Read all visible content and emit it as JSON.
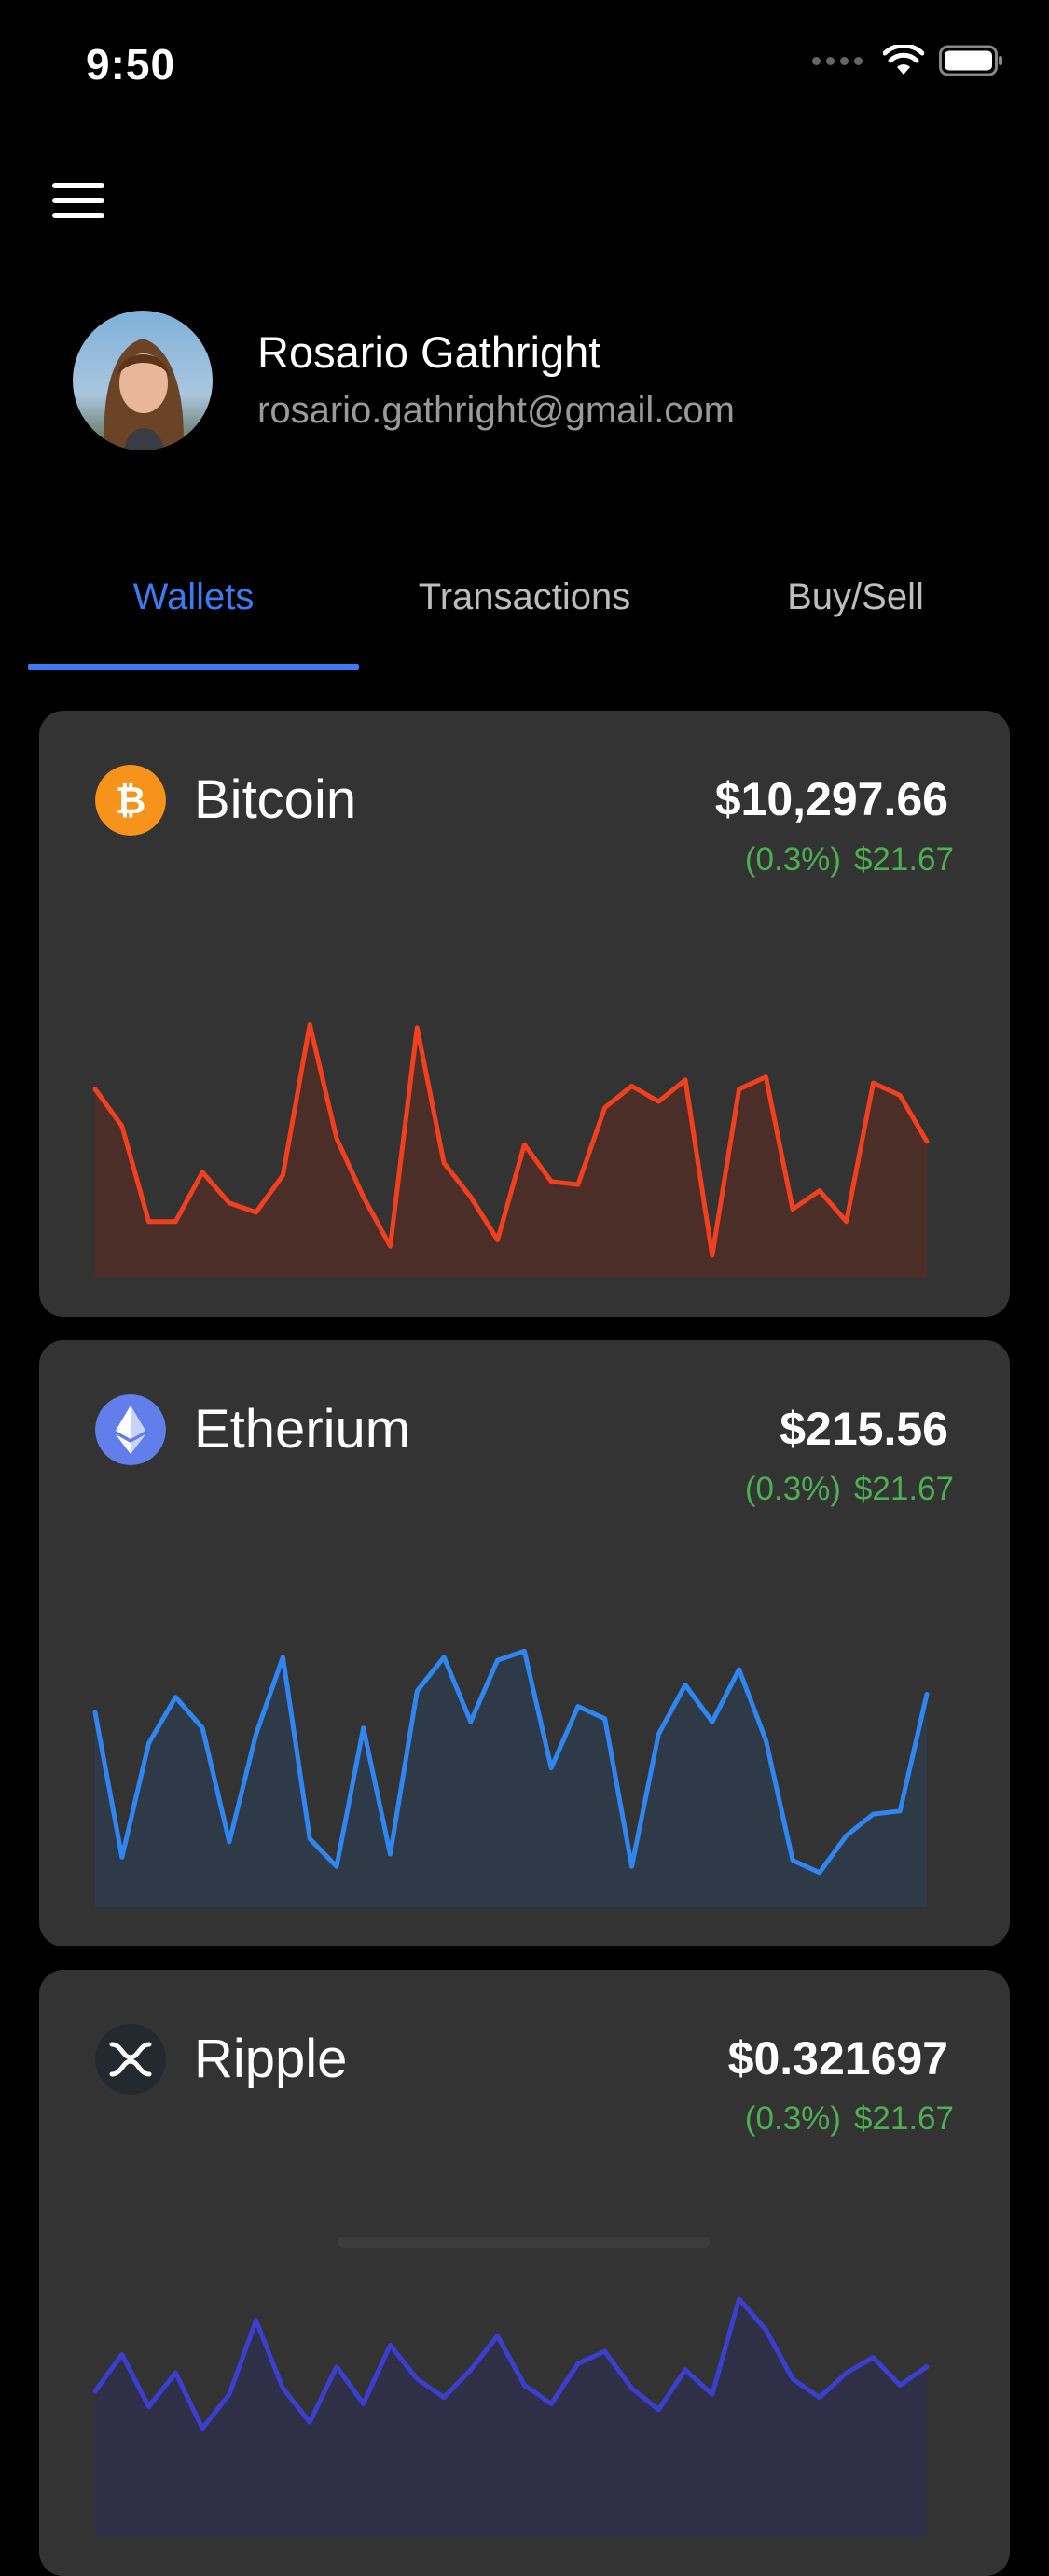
{
  "status_bar": {
    "time": "9:50"
  },
  "menu": {
    "icon": "hamburger-menu-icon"
  },
  "profile": {
    "name": "Rosario Gathright",
    "email": "rosario.gathright@gmail.com"
  },
  "tabs": [
    {
      "label": "Wallets",
      "active": true
    },
    {
      "label": "Transactions",
      "active": false
    },
    {
      "label": "Buy/Sell",
      "active": false
    }
  ],
  "colors": {
    "accent": "#3b7cf5",
    "positive": "#4caf50",
    "card_bg": "#333333",
    "bitcoin": "#f7931a",
    "bitcoin_line": "#f2401f",
    "ethereum": "#627eea",
    "ethereum_line": "#2f86f0",
    "ripple_line": "#3a3fd0"
  },
  "wallets": [
    {
      "name": "Bitcoin",
      "icon": "bitcoin-icon",
      "price": "$10,297.66",
      "change_percent": "(0.3%)",
      "change_amount": "$21.67"
    },
    {
      "name": "Etherium",
      "icon": "ethereum-icon",
      "price": "$215.56",
      "change_percent": "(0.3%)",
      "change_amount": "$21.67"
    },
    {
      "name": "Ripple",
      "icon": "ripple-icon",
      "price": "$0.321697",
      "change_percent": "(0.3%)",
      "change_amount": "$21.67"
    }
  ],
  "chart_data": [
    {
      "type": "area",
      "series": [
        {
          "values": [
            54,
            42,
            11,
            11,
            27,
            17,
            14,
            26,
            75,
            38,
            19,
            3,
            74,
            30,
            19,
            5,
            36,
            24,
            23,
            48,
            55,
            50,
            57,
            0,
            54,
            58,
            15,
            21,
            11,
            56,
            52,
            37
          ]
        }
      ]
    },
    {
      "type": "area",
      "series": [
        {
          "values": [
            56,
            9,
            46,
            61,
            51,
            14,
            49,
            74,
            15,
            6,
            51,
            10,
            63,
            74,
            53,
            73,
            76,
            38,
            58,
            54,
            6,
            49,
            65,
            53,
            70,
            47,
            8,
            4,
            16,
            23,
            24,
            62
          ]
        }
      ]
    },
    {
      "type": "area",
      "series": [
        {
          "values": [
            40,
            52,
            35,
            46,
            28,
            39,
            63,
            41,
            30,
            48,
            36,
            55,
            44,
            38,
            47,
            58,
            42,
            36,
            49,
            53,
            41,
            34,
            47,
            39,
            70,
            60,
            44,
            38,
            46,
            51,
            42,
            48
          ]
        }
      ]
    }
  ]
}
